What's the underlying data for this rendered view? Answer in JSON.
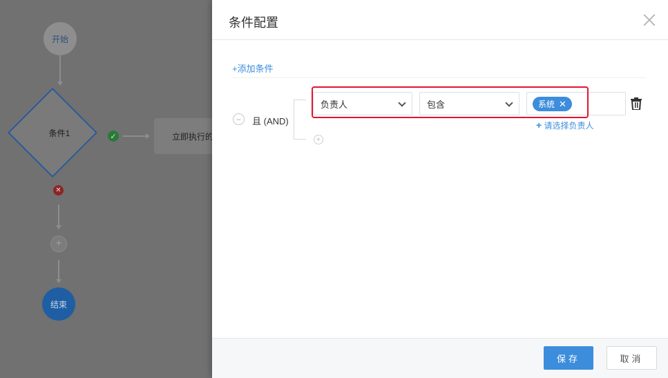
{
  "flow": {
    "start": "开始",
    "condition": "条件1",
    "action": "立即执行的",
    "add": "+",
    "end": "结束",
    "ok_icon": "check-circle-icon",
    "err_icon": "close-circle-icon"
  },
  "drawer": {
    "title": "条件配置",
    "add_condition": "+添加条件",
    "logic_label": "且 (AND)",
    "field_select": "负责人",
    "operator_select": "包含",
    "value_tags": [
      "系统"
    ],
    "pick_link": "请选择负责人",
    "save": "保存",
    "cancel": "取消"
  },
  "colors": {
    "accent": "#3c8ddb",
    "highlight": "#e2142f"
  }
}
